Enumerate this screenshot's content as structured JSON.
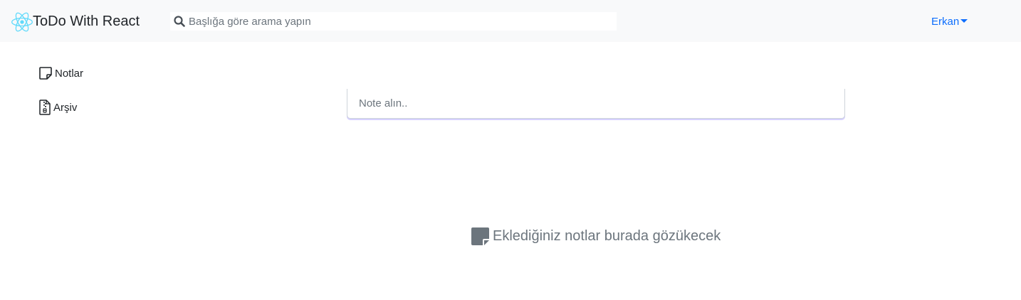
{
  "navbar": {
    "brand_text": "ToDo With React",
    "brand_icon": "react-logo-icon",
    "search_placeholder": "Başlığa göre arama yapın",
    "search_icon": "search-icon",
    "user_name": "Erkan"
  },
  "sidebar": {
    "items": [
      {
        "label": "Notlar",
        "icon": "sticky-note-icon"
      },
      {
        "label": "Arşiv",
        "icon": "archive-file-icon"
      }
    ]
  },
  "main": {
    "note_input_placeholder": "Note alın..",
    "empty_state_text": "Eklediğiniz notlar burada gözükecek",
    "empty_state_icon": "sticky-note-icon"
  },
  "colors": {
    "navbar_bg": "#f8f9fa",
    "accent": "#0d6efd",
    "react_cyan": "#61dafb",
    "muted_text": "#6c757d",
    "input_focus": "#8a78ff"
  }
}
